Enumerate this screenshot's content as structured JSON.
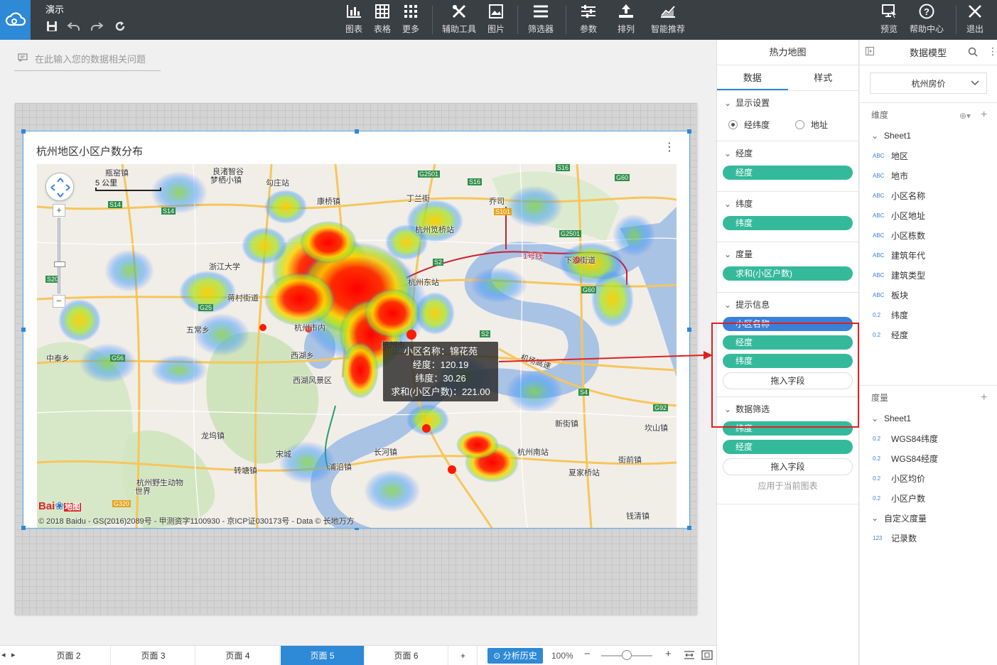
{
  "app": {
    "title": "演示",
    "quick_actions": [
      "save-icon",
      "undo-icon",
      "redo-icon",
      "refresh-icon"
    ]
  },
  "toolbar": {
    "chart": "图表",
    "table": "表格",
    "more": "更多",
    "tools": "辅助工具",
    "image": "图片",
    "filter": "筛选器",
    "params": "参数",
    "sort": "排列",
    "smart": "智能推荐",
    "preview": "预览",
    "help": "帮助中心",
    "exit": "退出"
  },
  "question": {
    "placeholder": "在此输入您的数据相关问题"
  },
  "chart": {
    "title": "杭州地区小区户数分布",
    "menu": "⋮",
    "scale_label": "5 公里",
    "copyright": "© 2018 Baidu - GS(2016)2089号 - 甲测资字1100930 - 京ICP证030173号 - Data © 长地万方",
    "logo_text": "Bai",
    "logo_text2": "地图",
    "tooltip": {
      "line1": "小区名称：锦花苑",
      "line2": "经度：120.19",
      "line3": "纬度：30.26",
      "line4": "求和(小区户数)：221.00"
    },
    "places": {
      "p1": "瓶窑镇",
      "p2": "良渚智谷",
      "p3": "梦栖小镇",
      "p4": "勾庄站",
      "p5": "康桥镇",
      "p6": "丁兰街",
      "p7": "乔司",
      "p8": "杭州笕桥站",
      "p9": "浙江大学",
      "p10": "杭州东站",
      "p11": "1号线",
      "p12": "下沙街道",
      "p13": "五常乡",
      "p14": "西湖乡",
      "p15": "西湖风景区",
      "p16": "杭州市",
      "p17": "机场高速",
      "p18": "新街镇",
      "p19": "坎山镇",
      "p20": "龙坞镇",
      "p21": "杭州南站",
      "p22": "夏家桥站",
      "p23": "街前镇",
      "p24": "杭州野生动物",
      "p25": "世界",
      "p26": "钱清镇",
      "p27": "转塘镇",
      "p28": "浦沿镇",
      "p29": "长河镇",
      "p30": "宋城",
      "p31": "蒋村街道",
      "p32": "中泰乡",
      "p33": "杭州市内"
    },
    "roads": {
      "s14a": "S14",
      "s14b": "S14",
      "g2501": "G2501",
      "g2501b": "G2501",
      "s16": "S16",
      "g60": "G60",
      "s101": "S101",
      "s2": "S2",
      "g25": "G25",
      "s20": "S20",
      "g56": "G56",
      "s2b": "S2",
      "s4": "S4",
      "g92": "G92",
      "g320": "G320",
      "g60b": "G60",
      "s16b": "S16"
    }
  },
  "property_panel": {
    "title": "热力地图",
    "tabs": [
      "数据",
      "样式"
    ],
    "display": {
      "label": "显示设置",
      "opt1": "经纬度",
      "opt2": "地址"
    },
    "longitude": {
      "label": "经度",
      "field": "经度"
    },
    "latitude": {
      "label": "纬度",
      "field": "纬度"
    },
    "measure": {
      "label": "度量",
      "field": "求和(小区户数)"
    },
    "tooltip": {
      "label": "提示信息",
      "fields": [
        "小区名称",
        "经度",
        "纬度"
      ],
      "drop": "拖入字段"
    },
    "filter": {
      "label": "数据筛选",
      "fields": [
        "纬度",
        "经度"
      ],
      "drop": "拖入字段",
      "apply": "应用于当前图表"
    }
  },
  "model_panel": {
    "title": "数据模型",
    "dataset": "杭州房价",
    "dimension_label": "维度",
    "dim_sheet": "Sheet1",
    "dimensions": [
      {
        "tag": "ABC",
        "name": "地区"
      },
      {
        "tag": "ABC",
        "name": "地市"
      },
      {
        "tag": "ABC",
        "name": "小区名称"
      },
      {
        "tag": "ABC",
        "name": "小区地址"
      },
      {
        "tag": "ABC",
        "name": "小区栋数"
      },
      {
        "tag": "ABC",
        "name": "建筑年代"
      },
      {
        "tag": "ABC",
        "name": "建筑类型"
      },
      {
        "tag": "ABC",
        "name": "板块"
      },
      {
        "tag": "0.2",
        "name": "纬度"
      },
      {
        "tag": "0.2",
        "name": "经度"
      }
    ],
    "measure_label": "度量",
    "mea_sheet": "Sheet1",
    "measures": [
      {
        "tag": "0.2",
        "name": "WGS84纬度"
      },
      {
        "tag": "0.2",
        "name": "WGS84经度"
      },
      {
        "tag": "0.2",
        "name": "小区均价"
      },
      {
        "tag": "0.2",
        "name": "小区户数"
      }
    ],
    "custom_label": "自定义度量",
    "custom": [
      {
        "tag": "123",
        "name": "记录数"
      }
    ]
  },
  "bottom": {
    "pages": [
      "页面 2",
      "页面 3",
      "页面 4",
      "页面 5",
      "页面 6"
    ],
    "active_page": "页面 5",
    "add": "+",
    "history": "分析历史",
    "zoom": "100%",
    "zoom_level": 0.5
  }
}
